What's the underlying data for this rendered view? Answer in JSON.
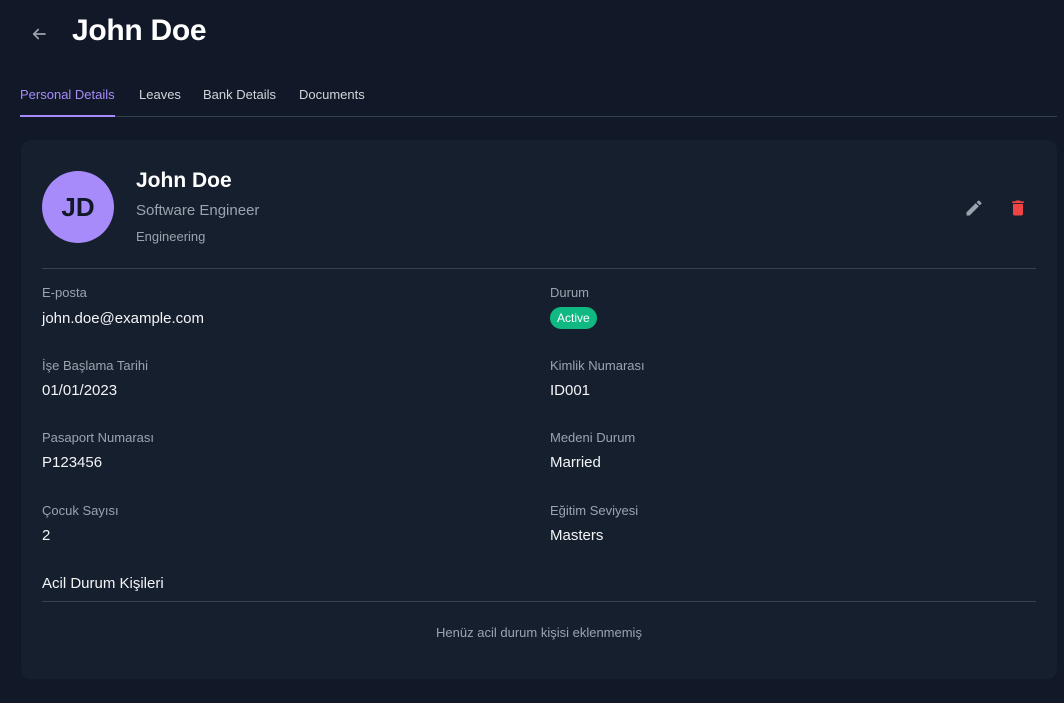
{
  "header": {
    "title": "John Doe",
    "back_icon": "arrow-left-icon"
  },
  "tabs": [
    {
      "label": "Personal Details",
      "active": true
    },
    {
      "label": "Leaves",
      "active": false
    },
    {
      "label": "Bank Details",
      "active": false
    },
    {
      "label": "Documents",
      "active": false
    }
  ],
  "profile": {
    "initials": "JD",
    "name": "John Doe",
    "role": "Software Engineer",
    "department": "Engineering",
    "edit_icon": "pencil-icon",
    "delete_icon": "trash-icon"
  },
  "fields": {
    "email": {
      "label": "E-posta",
      "value": "john.doe@example.com"
    },
    "status": {
      "label": "Durum",
      "value": "Active"
    },
    "start_date": {
      "label": "İşe Başlama Tarihi",
      "value": "01/01/2023"
    },
    "id_number": {
      "label": "Kimlik Numarası",
      "value": "ID001"
    },
    "passport": {
      "label": "Pasaport Numarası",
      "value": "P123456"
    },
    "marital": {
      "label": "Medeni Durum",
      "value": "Married"
    },
    "children": {
      "label": "Çocuk Sayısı",
      "value": "2"
    },
    "education": {
      "label": "Eğitim Seviyesi",
      "value": "Masters"
    }
  },
  "emergency": {
    "title": "Acil Durum Kişileri",
    "empty_text": "Henüz acil durum kişisi eklenmemiş"
  },
  "colors": {
    "background": "#111827",
    "card": "#161f2e",
    "accent": "#a78bfa",
    "status_active": "#10b981",
    "delete": "#ef4444"
  }
}
